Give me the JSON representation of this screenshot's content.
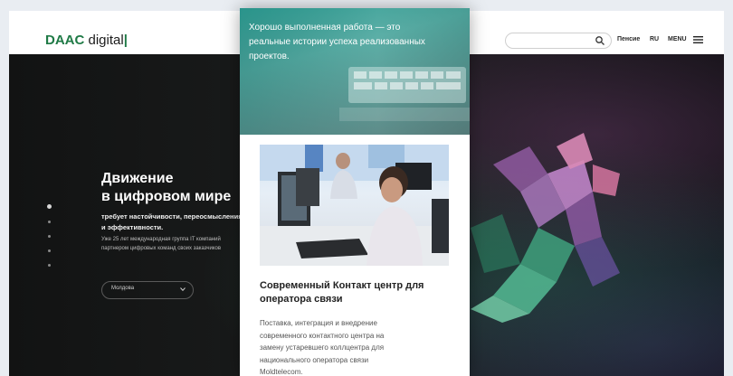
{
  "header": {
    "logo_primary": "DAAC",
    "logo_secondary": " digital",
    "logo_mark": "|",
    "nav": [
      {
        "label": "Пенсие"
      },
      {
        "label": "RU"
      },
      {
        "label": "MENU"
      }
    ],
    "search": {
      "placeholder": "",
      "icon": "search-icon"
    },
    "menu_icon": "hamburger-icon"
  },
  "hero": {
    "title": "Движение\nв цифровом мире",
    "subtitle": "требует настойчивости, переосмысления\nи эффективности.",
    "text": "Уже 25 лет международная группа IT компаний\nпартнером цифровых команд своих заказчиков",
    "region_select": {
      "value": "Молдова",
      "icon": "chevron-down-icon"
    },
    "pager_dots": 5
  },
  "card": {
    "banner_text": "Хорошо выполненная работа — это\nреальные истории успеха реализованных\nпроектов.",
    "title": "Современный Контакт центр для\nоператора связи",
    "description": "Поставка, интеграция и внедрение\nсовременного контактного центра на\nзамену устаревшего коллцентра для\nнационального оператора связи\nMoldtelecom."
  },
  "colors": {
    "brand_green": "#1f7a46",
    "hero_bg": "#121313",
    "banner_teal": "#1e968c"
  }
}
